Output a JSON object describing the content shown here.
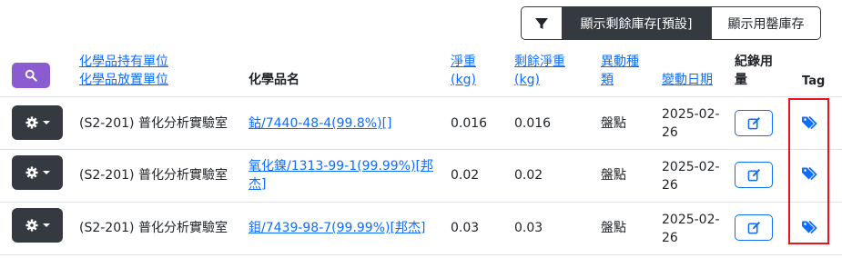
{
  "toolbar": {
    "filter_icon": "filter-icon",
    "show_remaining_label": "顯示剩餘庫存[預設]",
    "show_used_label": "顯示用罄庫存"
  },
  "header": {
    "search_icon": "search-icon",
    "holder_unit": "化學品持有單位",
    "storage_unit": "化學品放置單位",
    "chemical_name": "化學品名",
    "net_weight": [
      "淨重",
      "(kg)"
    ],
    "remaining_weight": [
      "剩餘淨重",
      "(kg)"
    ],
    "change_type": [
      "異動種",
      "類"
    ],
    "change_date": "變動日期",
    "record_usage": [
      "紀錄用",
      "量"
    ],
    "tag": "Tag"
  },
  "rows": [
    {
      "unit": "(S2-201) 普化分析實驗室",
      "chemical": [
        "鈷/7440-48-4(99.8%)[]"
      ],
      "net_weight": "0.016",
      "remaining": "0.016",
      "change_type": "盤點",
      "date": [
        "2025-02-",
        "26"
      ]
    },
    {
      "unit": "(S2-201) 普化分析實驗室",
      "chemical": [
        "氧化鎳/1313-99-1(99.99%)[邦",
        "杰]"
      ],
      "net_weight": "0.02",
      "remaining": "0.02",
      "change_type": "盤點",
      "date": [
        "2025-02-",
        "26"
      ]
    },
    {
      "unit": "(S2-201) 普化分析實驗室",
      "chemical": [
        "鉬/7439-98-7(99.99%)[邦杰]"
      ],
      "net_weight": "0.03",
      "remaining": "0.03",
      "change_type": "盤點",
      "date": [
        "2025-02-",
        "26"
      ]
    }
  ],
  "icons": {
    "row_menu": "gear-icon",
    "record": "edit-icon",
    "tag": "tag-icon"
  },
  "colors": {
    "link": "#0d6efd",
    "dark": "#343a40",
    "search_button": "#8a5ccf",
    "highlight_box": "#e8141e"
  }
}
